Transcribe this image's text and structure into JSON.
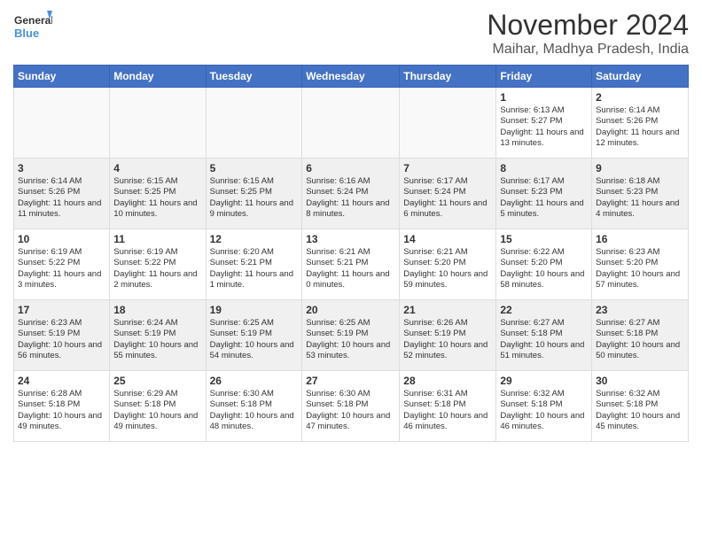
{
  "header": {
    "logo_line1": "General",
    "logo_line2": "Blue",
    "month_title": "November 2024",
    "location": "Maihar, Madhya Pradesh, India"
  },
  "weekdays": [
    "Sunday",
    "Monday",
    "Tuesday",
    "Wednesday",
    "Thursday",
    "Friday",
    "Saturday"
  ],
  "weeks": [
    [
      {
        "day": "",
        "info": ""
      },
      {
        "day": "",
        "info": ""
      },
      {
        "day": "",
        "info": ""
      },
      {
        "day": "",
        "info": ""
      },
      {
        "day": "",
        "info": ""
      },
      {
        "day": "1",
        "info": "Sunrise: 6:13 AM\nSunset: 5:27 PM\nDaylight: 11 hours and 13 minutes."
      },
      {
        "day": "2",
        "info": "Sunrise: 6:14 AM\nSunset: 5:26 PM\nDaylight: 11 hours and 12 minutes."
      }
    ],
    [
      {
        "day": "3",
        "info": "Sunrise: 6:14 AM\nSunset: 5:26 PM\nDaylight: 11 hours and 11 minutes."
      },
      {
        "day": "4",
        "info": "Sunrise: 6:15 AM\nSunset: 5:25 PM\nDaylight: 11 hours and 10 minutes."
      },
      {
        "day": "5",
        "info": "Sunrise: 6:15 AM\nSunset: 5:25 PM\nDaylight: 11 hours and 9 minutes."
      },
      {
        "day": "6",
        "info": "Sunrise: 6:16 AM\nSunset: 5:24 PM\nDaylight: 11 hours and 8 minutes."
      },
      {
        "day": "7",
        "info": "Sunrise: 6:17 AM\nSunset: 5:24 PM\nDaylight: 11 hours and 6 minutes."
      },
      {
        "day": "8",
        "info": "Sunrise: 6:17 AM\nSunset: 5:23 PM\nDaylight: 11 hours and 5 minutes."
      },
      {
        "day": "9",
        "info": "Sunrise: 6:18 AM\nSunset: 5:23 PM\nDaylight: 11 hours and 4 minutes."
      }
    ],
    [
      {
        "day": "10",
        "info": "Sunrise: 6:19 AM\nSunset: 5:22 PM\nDaylight: 11 hours and 3 minutes."
      },
      {
        "day": "11",
        "info": "Sunrise: 6:19 AM\nSunset: 5:22 PM\nDaylight: 11 hours and 2 minutes."
      },
      {
        "day": "12",
        "info": "Sunrise: 6:20 AM\nSunset: 5:21 PM\nDaylight: 11 hours and 1 minute."
      },
      {
        "day": "13",
        "info": "Sunrise: 6:21 AM\nSunset: 5:21 PM\nDaylight: 11 hours and 0 minutes."
      },
      {
        "day": "14",
        "info": "Sunrise: 6:21 AM\nSunset: 5:20 PM\nDaylight: 10 hours and 59 minutes."
      },
      {
        "day": "15",
        "info": "Sunrise: 6:22 AM\nSunset: 5:20 PM\nDaylight: 10 hours and 58 minutes."
      },
      {
        "day": "16",
        "info": "Sunrise: 6:23 AM\nSunset: 5:20 PM\nDaylight: 10 hours and 57 minutes."
      }
    ],
    [
      {
        "day": "17",
        "info": "Sunrise: 6:23 AM\nSunset: 5:19 PM\nDaylight: 10 hours and 56 minutes."
      },
      {
        "day": "18",
        "info": "Sunrise: 6:24 AM\nSunset: 5:19 PM\nDaylight: 10 hours and 55 minutes."
      },
      {
        "day": "19",
        "info": "Sunrise: 6:25 AM\nSunset: 5:19 PM\nDaylight: 10 hours and 54 minutes."
      },
      {
        "day": "20",
        "info": "Sunrise: 6:25 AM\nSunset: 5:19 PM\nDaylight: 10 hours and 53 minutes."
      },
      {
        "day": "21",
        "info": "Sunrise: 6:26 AM\nSunset: 5:19 PM\nDaylight: 10 hours and 52 minutes."
      },
      {
        "day": "22",
        "info": "Sunrise: 6:27 AM\nSunset: 5:18 PM\nDaylight: 10 hours and 51 minutes."
      },
      {
        "day": "23",
        "info": "Sunrise: 6:27 AM\nSunset: 5:18 PM\nDaylight: 10 hours and 50 minutes."
      }
    ],
    [
      {
        "day": "24",
        "info": "Sunrise: 6:28 AM\nSunset: 5:18 PM\nDaylight: 10 hours and 49 minutes."
      },
      {
        "day": "25",
        "info": "Sunrise: 6:29 AM\nSunset: 5:18 PM\nDaylight: 10 hours and 49 minutes."
      },
      {
        "day": "26",
        "info": "Sunrise: 6:30 AM\nSunset: 5:18 PM\nDaylight: 10 hours and 48 minutes."
      },
      {
        "day": "27",
        "info": "Sunrise: 6:30 AM\nSunset: 5:18 PM\nDaylight: 10 hours and 47 minutes."
      },
      {
        "day": "28",
        "info": "Sunrise: 6:31 AM\nSunset: 5:18 PM\nDaylight: 10 hours and 46 minutes."
      },
      {
        "day": "29",
        "info": "Sunrise: 6:32 AM\nSunset: 5:18 PM\nDaylight: 10 hours and 46 minutes."
      },
      {
        "day": "30",
        "info": "Sunrise: 6:32 AM\nSunset: 5:18 PM\nDaylight: 10 hours and 45 minutes."
      }
    ]
  ]
}
